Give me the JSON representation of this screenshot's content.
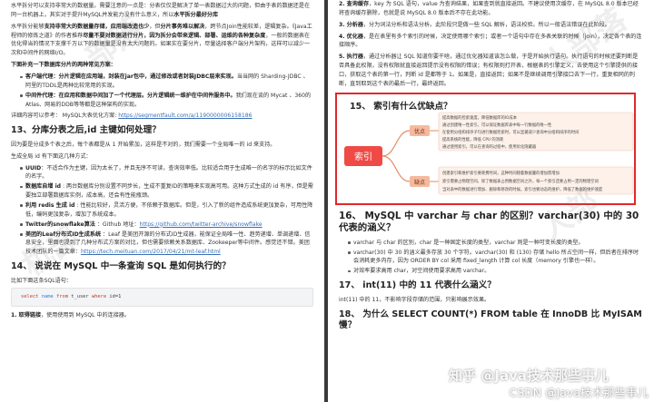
{
  "left": {
    "p1": "水平拆分可以支持非常大的数据量。需要注意的一点是：分表仅仅是解决了单一表数据过大的问题，但由于表的数据还是在同一台机器上，其实对于提升MySQL并发能力没有什么意义，所以",
    "p1_bold": "水平拆分最好分库",
    "p2_lead": "水平拆分能够",
    "p2_bold": "支持非常大的数据量存储，应用端改造也少",
    "p2_mid": "，但",
    "p2_bold2": "分片事务难以解决",
    "p2_rest": "，跨节点Join性能较差，逻辑复杂。《Java工程师的修炼之道》的作者推荐",
    "p2_bold3": "尽量不要对数据进行分片，因为拆分会带来逻辑、部署、运维的各种复杂度",
    "p2_tail": "，一般的数据表在优化得当的情况下支撑千万以下的数据量是没有太大问题的。如果实在要分片，尽量选择客户端分片架构，这样可以减少一次和中间件的网络I/O。",
    "p3": "下面补充一下数据库分片的两种常见方案：",
    "b1_bold": "客户端代理：分片逻辑在应用端，封装在jar包中，通过修改或者封装JDBC层来实现。",
    "b1_rest": "当当网的 Sharding-JDBC 、阿里的TDDL是两种比较常用的实现。",
    "b2_bold": "中间件代理：在应用和数据中间加了一个代理层。分片逻辑统一维护在中间件服务中。",
    "b2_rest": "我们现在谈的 Mycat 、360的Atlas、网易的DDB等等都是这种架构的实现。",
    "ref_text": "详细内容可以参考： MySQL大表优化方案: ",
    "ref_link": "https://segmentfault.com/a/1190000006158186",
    "h13": "13、分库分表之后,id 主键如何处理？",
    "p4": "因为要是分成多个表之后，每个表都是从 1 开始累加，这样是不对的，我们需要一个全局唯一的 id 来支持。",
    "p5": "生成全局 id 有下面这几种方式：",
    "c1_bold": "UUID",
    "c1_rest": "：不适合作为主键，因为太长了，并且无序不可读，查询效率低。比较适合用于生成唯一的名字的标示比如文件的名字。",
    "c2_bold": "数据库自增 id",
    "c2_rest": " : 两台数据库分别设置不同步长，生成不重复ID的策略来实现高可用。这种方式生成的 id 有序，但是需要独立部署数据库实例，成本高，还会有性能瓶颈。",
    "c3_bold": "利用 redis 生成 id",
    "c3_rest": " : 性能比较好，灵活方便，不依赖于数据库。但是，引入了新的组件造成系统更加复杂，可用性降低，编码更加复杂，增加了系统成本。",
    "c4_bold": "Twitter的snowflake算法",
    "c4_rest": " ：Github 地址：",
    "c4_link": "https://github.com/twitter-archive/snowflake",
    "c5_bold": "美团的Leaf分布式ID生成系统",
    "c5_rest": " ：Leaf 是美团开源的分布式ID生成器，能保证全局唯一性、趋势递增、单调递增、信息安全，里面也提到了几种分布式方案的对比，但也需要依赖关系数据库、Zookeeper等中间件。感觉还不错。美团技术团队的一篇文章：",
    "c5_link": "https://tech.meituan.com/2017/04/21/mt-leaf.html",
    "h14": "14、 说说在 MySQL 中一条查询 SQL 是如何执行的？",
    "p6": "比如下面这条SQL语句：",
    "code_kw1": "select",
    "code_nm": "name",
    "code_kw2": "from",
    "code_tbl": "t_user",
    "code_kw3": "where",
    "code_cond": "id=1",
    "step1_bold": "1. 取得链接",
    "step1_rest": "，使用使用到 MySQL 中的连接器。"
  },
  "right": {
    "s2_bold": "2. 查询缓存",
    "s2_rest": "，key 为 SQL 语句，value 为查询结果，如果查到就直接返回。不建议使用次缓存，在 MySQL 8.0 版本已经将查询缓存删除，也就是说 MySQL 8.0 版本后不存在此功能。",
    "s3_bold": "3. 分析器",
    "s3_rest": "，分为词法分析和语法分析。此阶段只是做一些 SQL 解析，语法校验。所以一般语法错误在此阶段。",
    "s4_bold": "4. 优化器",
    "s4_rest": "，是在表里有多个索引的时候，决定使用哪个索引；或者一个语句中存在多表关联的时候（join），决定各个表的连接顺序。",
    "s5_bold": "5. 执行器",
    "s5_rest": "，通过分析器让 SQL 知道你要干啥，通过优化器知道该怎么做，于是开始执行语句。执行语句的时候还要判断是否具备此权限，没有权限就直接返回提示没有权限的错误；有权限则打开表，根据表的引擎定义，去使用这个引擎提供的接口，获取这个表的第一行，判断 id 是都等于 1。如果是，直接返回；如果不是继续调用引擎接口去下一行，重复相同的判断，直到取到这个表的最后一行，最终返回。",
    "h15": "15、 索引有什么优缺点？",
    "diagram": {
      "center": "索引",
      "pro": "优点",
      "con": "缺点",
      "pro_items": [
        "提高数据的检索速度，降低数据库的IO成本",
        "通过创建唯一性索引，可以保证数据库表中每一行数据的唯一性",
        "在使用分组和排序子句进行数据检索时，可以显著减少查询中分组和排序的时间",
        "提高系统的性能，降低 CPU 的消耗",
        "通过使用索引，可以在查询的过程中，使用优化隐藏器"
      ],
      "con_items": [
        "创建索引和维护索引要耗费时间，这种时间随着数据量的增加而增加",
        "索引需要占物理空间，除了数据表占用数据空间之外，每一个索引还要占用一定的物理空间",
        "当对表中的数据进行增加、删除和修改的时候，索引也要动态的维护，降低了数据的维护速度"
      ]
    },
    "h16": "16、 MySQL 中 varchar 与 char 的区别？varchar(30) 中的 30 代表的涵义？",
    "v1": "varchar 与 char 的区别，char 是一种固定长度的类型，varchar 则是一种可变长度的类型。",
    "v2": "varchar(30) 中 30 的涵义最多存放 30 个字符。varchar(30) 和 (130) 存储 hello 所占空间一样，但后者在排序时会消耗更多内存，因为 ORDER BY col 采用 fixed_length 计算 col 长度（memory 引擎也一样）。",
    "v3": "对效率要求高用 char，对空间使用要求高用 varchar。",
    "h17": "17、 int(11) 中的 11 代表什么涵义？",
    "p17": "int(11) 中的 11，不影响字段存储的范围，只影响展示效果。",
    "h18": "18、 为什么 SELECT COUNT(*) FROM table 在 InnoDB 比 MyISAM 慢？"
  },
  "watermarks": [
    "部落",
    "机部",
    "人部落",
    "人部"
  ],
  "footer": {
    "zhihu": "知乎 @Java技术那些事儿",
    "csdn": "CSDN @Java技术那些事儿"
  },
  "colors": {
    "highlight": "#e0282b",
    "link": "#3b6fb6",
    "center_node": "#ef4a45",
    "branch": "#e48a62"
  }
}
